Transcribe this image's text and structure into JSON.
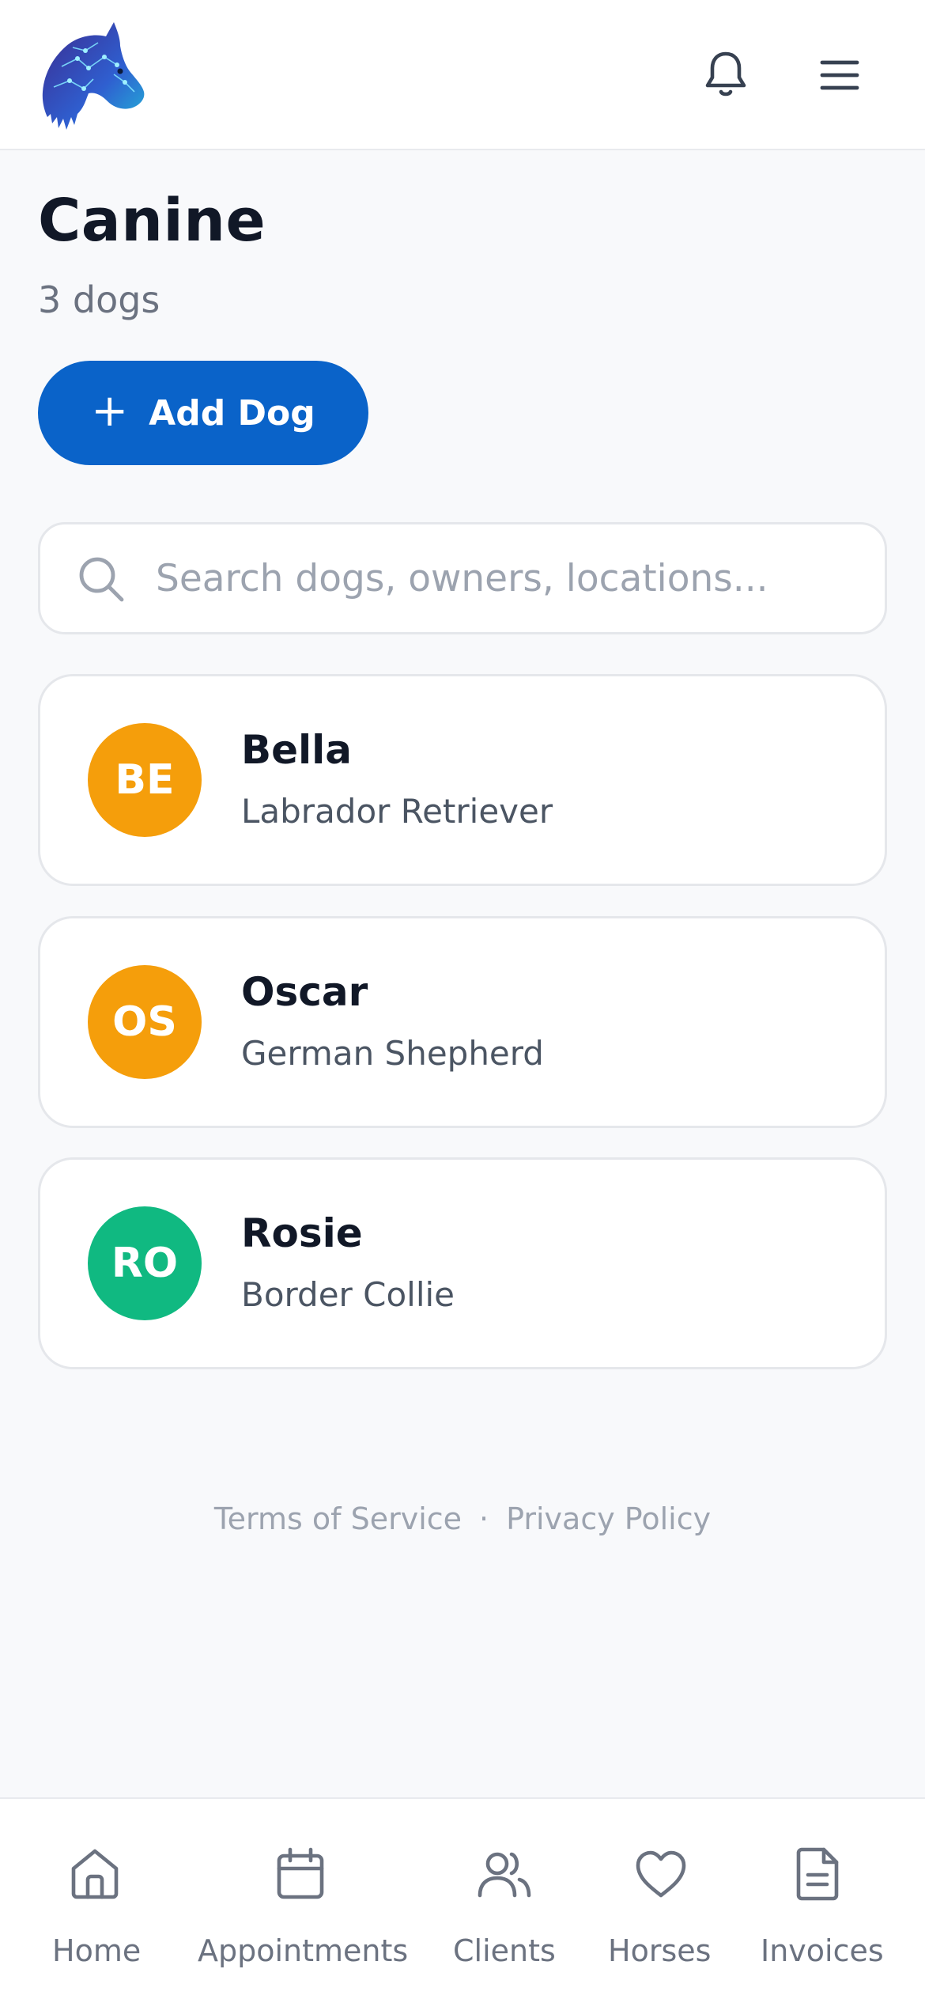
{
  "header": {
    "logo_icon": "horse-head-logo-icon",
    "notifications_icon": "bell-icon",
    "menu_icon": "hamburger-menu-icon"
  },
  "page": {
    "title": "Canine",
    "count": "3 dogs"
  },
  "add_button": {
    "label": "Add Dog",
    "icon": "+"
  },
  "search": {
    "placeholder": "Search dogs, owners, locations...",
    "value": ""
  },
  "dogs": [
    {
      "initials": "BE",
      "name": "Bella",
      "breed": "Labrador Retriever",
      "color": "#f59e0b"
    },
    {
      "initials": "OS",
      "name": "Oscar",
      "breed": "German Shepherd",
      "color": "#f59e0b"
    },
    {
      "initials": "RO",
      "name": "Rosie",
      "breed": "Border Collie",
      "color": "#10b981"
    }
  ],
  "footer": {
    "terms": "Terms of Service",
    "separator": "·",
    "privacy": "Privacy Policy"
  },
  "nav": [
    {
      "label": "Home",
      "icon": "home-icon"
    },
    {
      "label": "Appointments",
      "icon": "calendar-icon"
    },
    {
      "label": "Clients",
      "icon": "users-icon"
    },
    {
      "label": "Horses",
      "icon": "heart-icon"
    },
    {
      "label": "Invoices",
      "icon": "document-icon"
    }
  ],
  "colors": {
    "accent": "#0a63c9",
    "background": "#f8f9fb",
    "text_primary": "#111827",
    "text_secondary": "#6b7280"
  }
}
